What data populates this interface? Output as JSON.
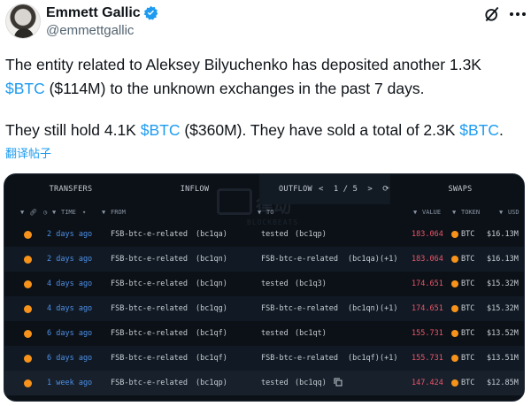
{
  "author": {
    "name": "Emmett Gallic",
    "handle": "@emmettgallic"
  },
  "tweet": {
    "line1_a": "The entity related to Aleksey Bilyuchenko has deposited another 1.3K",
    "line2_cash": "$BTC",
    "line2_b": " ($114M)  to the unknown exchanges in the past 7 days.",
    "line3_a": "They still hold 4.1K ",
    "line3_cash1": "$BTC",
    "line3_b": " ($360M). They have sold a total of 2.3K ",
    "line3_cash2": "$BTC",
    "line3_c": "."
  },
  "translate_label": "翻译帖子",
  "card": {
    "tabs": {
      "transfers": "TRANSFERS",
      "inflow": "INFLOW",
      "outflow": "OUTFLOW",
      "swaps": "SWAPS"
    },
    "pager": {
      "prev": "<",
      "page": "1 / 5",
      "next": ">",
      "refresh": "⟳"
    },
    "watermark": {
      "text": "律动",
      "sub": "BLOCKBEATS"
    },
    "columns": {
      "time": "TIME",
      "from": "FROM",
      "to": "TO",
      "value": "VALUE",
      "token": "TOKEN",
      "usd": "USD"
    },
    "rows": [
      {
        "time": "2 days ago",
        "from": "FSB-btc-e-related",
        "from_addr": "(bc1qa)",
        "to": "tested",
        "to_addr": "(bc1qp)",
        "to_extra": "",
        "value": "183.064",
        "token": "BTC",
        "usd": "$16.13M"
      },
      {
        "time": "2 days ago",
        "from": "FSB-btc-e-related",
        "from_addr": "(bc1qn)",
        "to": "FSB-btc-e-related",
        "to_addr": "(bc1qa)",
        "to_extra": "(+1)",
        "value": "183.064",
        "token": "BTC",
        "usd": "$16.13M"
      },
      {
        "time": "4 days ago",
        "from": "FSB-btc-e-related",
        "from_addr": "(bc1qn)",
        "to": "tested",
        "to_addr": "(bc1q3)",
        "to_extra": "",
        "value": "174.651",
        "token": "BTC",
        "usd": "$15.32M"
      },
      {
        "time": "4 days ago",
        "from": "FSB-btc-e-related",
        "from_addr": "(bc1qg)",
        "to": "FSB-btc-e-related",
        "to_addr": "(bc1qn)",
        "to_extra": "(+1)",
        "value": "174.651",
        "token": "BTC",
        "usd": "$15.32M"
      },
      {
        "time": "6 days ago",
        "from": "FSB-btc-e-related",
        "from_addr": "(bc1qf)",
        "to": "tested",
        "to_addr": "(bc1qt)",
        "to_extra": "",
        "value": "155.731",
        "token": "BTC",
        "usd": "$13.52M"
      },
      {
        "time": "6 days ago",
        "from": "FSB-btc-e-related",
        "from_addr": "(bc1qf)",
        "to": "FSB-btc-e-related",
        "to_addr": "(bc1qf)",
        "to_extra": "(+1)",
        "value": "155.731",
        "token": "BTC",
        "usd": "$13.51M"
      },
      {
        "time": "1 week ago",
        "from": "FSB-btc-e-related",
        "from_addr": "(bc1qp)",
        "to": "tested",
        "to_addr": "(bc1qq)",
        "to_extra": "",
        "value": "147.424",
        "token": "BTC",
        "usd": "$12.85M"
      }
    ]
  },
  "colors": {
    "link_blue": "#1d9bf0",
    "card_bg": "#0c1117",
    "time_blue": "#4e8fe6",
    "value_red": "#e9566a",
    "btc_orange": "#f7931a"
  },
  "icons": [
    "verified-badge-icon",
    "grok-icon",
    "more-icon",
    "filter-icon",
    "link-icon",
    "clock-icon",
    "copy-icon",
    "refresh-icon",
    "btc-icon"
  ]
}
